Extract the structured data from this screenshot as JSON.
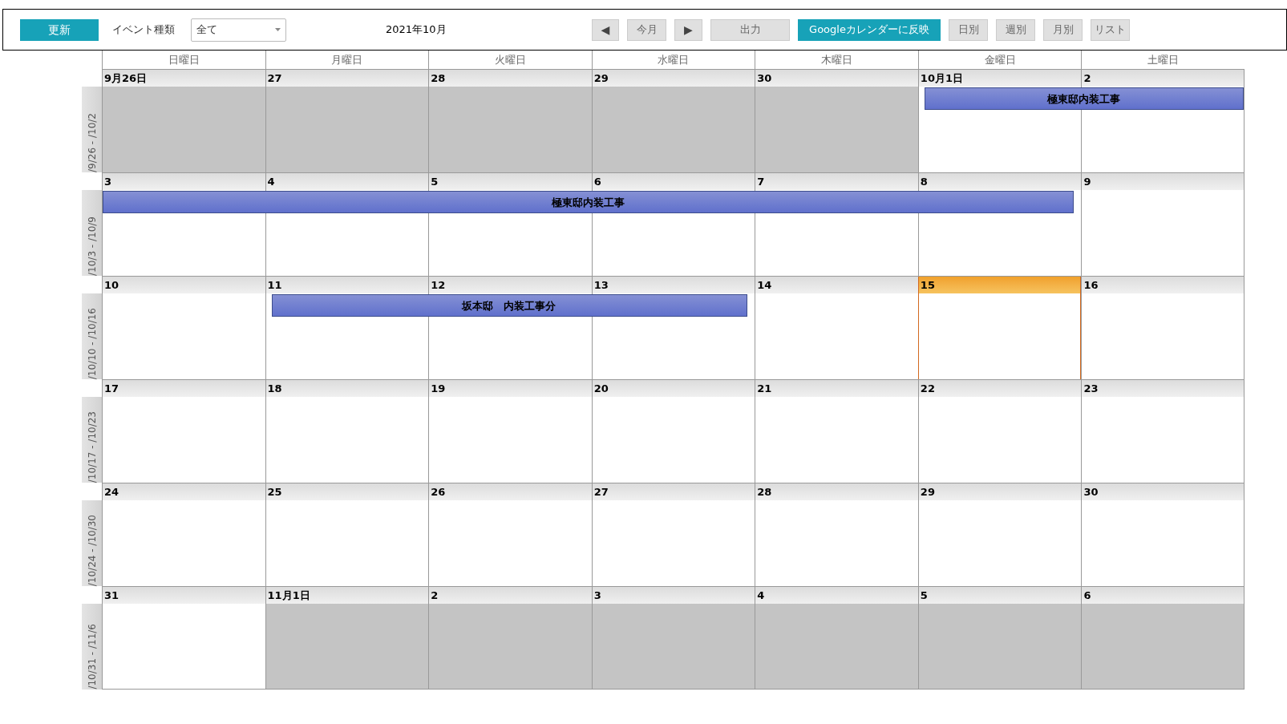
{
  "toolbar": {
    "refresh_button": "更新",
    "event_type_label": "イベント種類",
    "event_type_select": "全て",
    "month_title": "2021年10月",
    "buttons": [
      {
        "kind": "prev",
        "label": "◀"
      },
      {
        "kind": "plain",
        "label": "今月"
      },
      {
        "kind": "next",
        "label": "▶"
      },
      {
        "kind": "wide",
        "label": "出力"
      },
      {
        "kind": "primary",
        "label": "Googleカレンダーに反映"
      },
      {
        "kind": "plain",
        "label": "日別"
      },
      {
        "kind": "plain",
        "label": "週別"
      },
      {
        "kind": "plain",
        "label": "月別"
      },
      {
        "kind": "plain",
        "label": "リスト"
      }
    ]
  },
  "weekdays": [
    "日曜日",
    "月曜日",
    "火曜日",
    "水曜日",
    "木曜日",
    "金曜日",
    "土曜日"
  ],
  "weeks": [
    {
      "label": "/9/26 - /10/2",
      "days": [
        {
          "date": "9月26日",
          "other_month": true,
          "today": false
        },
        {
          "date": "27",
          "other_month": true,
          "today": false
        },
        {
          "date": "28",
          "other_month": true,
          "today": false
        },
        {
          "date": "29",
          "other_month": true,
          "today": false
        },
        {
          "date": "30",
          "other_month": true,
          "today": false
        },
        {
          "date": "10月1日",
          "other_month": false,
          "today": false
        },
        {
          "date": "2",
          "other_month": false,
          "today": false
        }
      ],
      "events": [
        {
          "title": "極東邸内装工事",
          "covers": [
            false,
            false,
            false,
            false,
            false,
            true,
            true
          ]
        }
      ]
    },
    {
      "label": "/10/3 - /10/9",
      "days": [
        {
          "date": "3",
          "other_month": false,
          "today": false
        },
        {
          "date": "4",
          "other_month": false,
          "today": false
        },
        {
          "date": "5",
          "other_month": false,
          "today": false
        },
        {
          "date": "6",
          "other_month": false,
          "today": false
        },
        {
          "date": "7",
          "other_month": false,
          "today": false
        },
        {
          "date": "8",
          "other_month": false,
          "today": false
        },
        {
          "date": "9",
          "other_month": false,
          "today": false
        }
      ],
      "events": [
        {
          "title": "極東邸内装工事",
          "covers": [
            true,
            true,
            true,
            true,
            true,
            true,
            false
          ]
        }
      ]
    },
    {
      "label": "/10/10 - /10/16",
      "days": [
        {
          "date": "10",
          "other_month": false,
          "today": false
        },
        {
          "date": "11",
          "other_month": false,
          "today": false
        },
        {
          "date": "12",
          "other_month": false,
          "today": false
        },
        {
          "date": "13",
          "other_month": false,
          "today": false
        },
        {
          "date": "14",
          "other_month": false,
          "today": false
        },
        {
          "date": "15",
          "other_month": false,
          "today": true
        },
        {
          "date": "16",
          "other_month": false,
          "today": false
        }
      ],
      "events": [
        {
          "title": "坂本邸　内装工事分",
          "covers": [
            false,
            true,
            true,
            true,
            false,
            false,
            false
          ]
        }
      ]
    },
    {
      "label": "/10/17 - /10/23",
      "days": [
        {
          "date": "17",
          "other_month": false,
          "today": false
        },
        {
          "date": "18",
          "other_month": false,
          "today": false
        },
        {
          "date": "19",
          "other_month": false,
          "today": false
        },
        {
          "date": "20",
          "other_month": false,
          "today": false
        },
        {
          "date": "21",
          "other_month": false,
          "today": false
        },
        {
          "date": "22",
          "other_month": false,
          "today": false
        },
        {
          "date": "23",
          "other_month": false,
          "today": false
        }
      ]
    },
    {
      "label": "/10/24 - /10/30",
      "days": [
        {
          "date": "24",
          "other_month": false,
          "today": false
        },
        {
          "date": "25",
          "other_month": false,
          "today": false
        },
        {
          "date": "26",
          "other_month": false,
          "today": false
        },
        {
          "date": "27",
          "other_month": false,
          "today": false
        },
        {
          "date": "28",
          "other_month": false,
          "today": false
        },
        {
          "date": "29",
          "other_month": false,
          "today": false
        },
        {
          "date": "30",
          "other_month": false,
          "today": false
        }
      ]
    },
    {
      "label": "/10/31 - /11/6",
      "days": [
        {
          "date": "31",
          "other_month": false,
          "today": false
        },
        {
          "date": "11月1日",
          "other_month": true,
          "today": false
        },
        {
          "date": "2",
          "other_month": true,
          "today": false
        },
        {
          "date": "3",
          "other_month": true,
          "today": false
        },
        {
          "date": "4",
          "other_month": true,
          "today": false
        },
        {
          "date": "5",
          "other_month": true,
          "today": false
        },
        {
          "date": "6",
          "other_month": true,
          "today": false
        }
      ]
    }
  ]
}
